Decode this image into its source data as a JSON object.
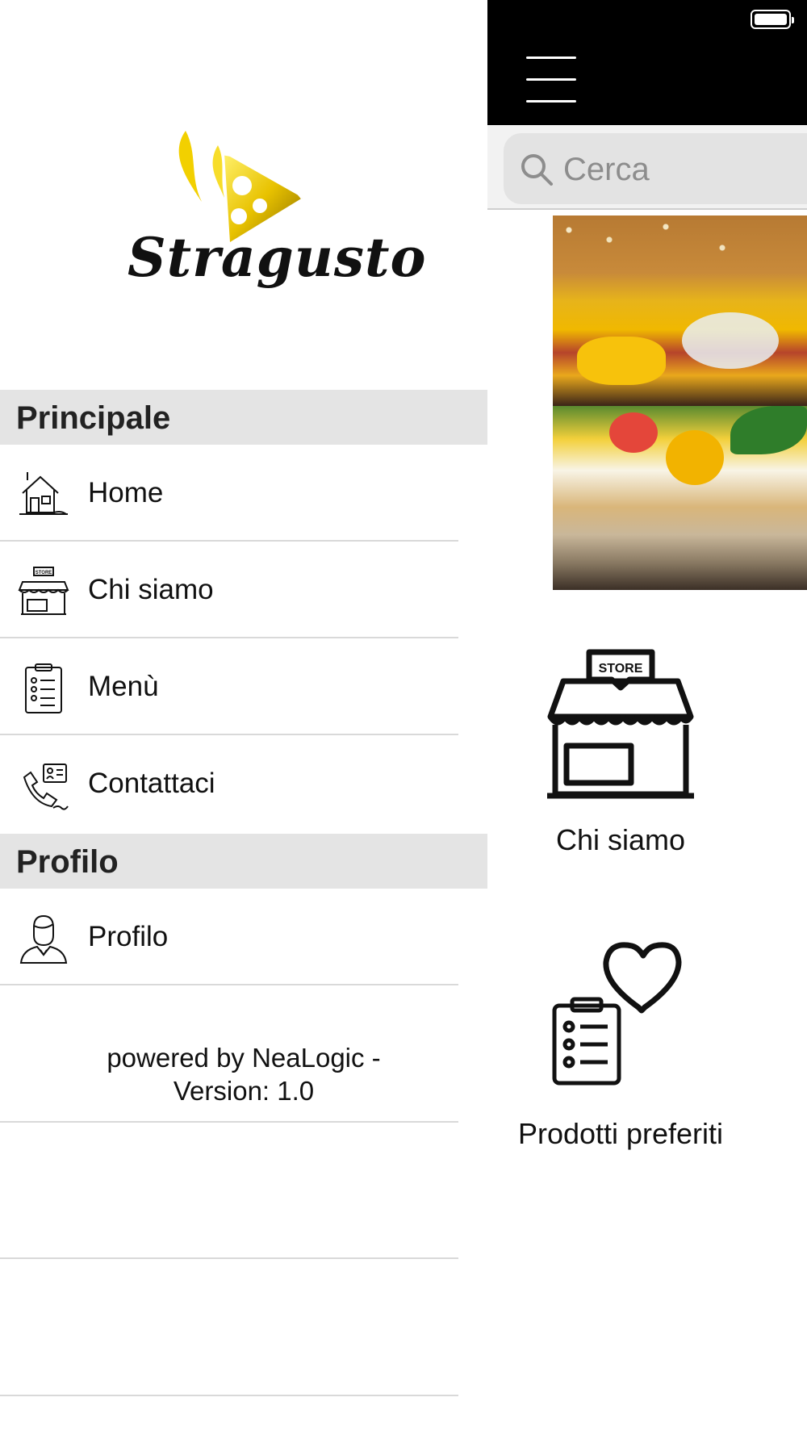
{
  "app": {
    "brand": "Stragusto"
  },
  "drawer": {
    "sections": [
      {
        "title": "Principale"
      },
      {
        "title": "Profilo"
      }
    ],
    "items": [
      {
        "label": "Home",
        "icon": "house-icon"
      },
      {
        "label": "Chi siamo",
        "icon": "store-icon"
      },
      {
        "label": "Menù",
        "icon": "clipboard-list-icon"
      },
      {
        "label": "Contattaci",
        "icon": "contact-phone-icon"
      },
      {
        "label": "Profilo",
        "icon": "user-icon"
      }
    ],
    "footer": {
      "line1": "powered by NeaLogic -",
      "line2": "Version: 1.0"
    }
  },
  "main": {
    "search": {
      "placeholder": "Cerca",
      "value": ""
    },
    "tiles": [
      {
        "label": "Chi siamo",
        "icon": "store-icon"
      },
      {
        "label": "Prodotti preferiti",
        "icon": "favorites-clipboard-heart-icon"
      }
    ]
  },
  "colors": {
    "topbar": "#000000",
    "section_header_bg": "#e4e4e4",
    "logo_gold": "#e8c200"
  }
}
